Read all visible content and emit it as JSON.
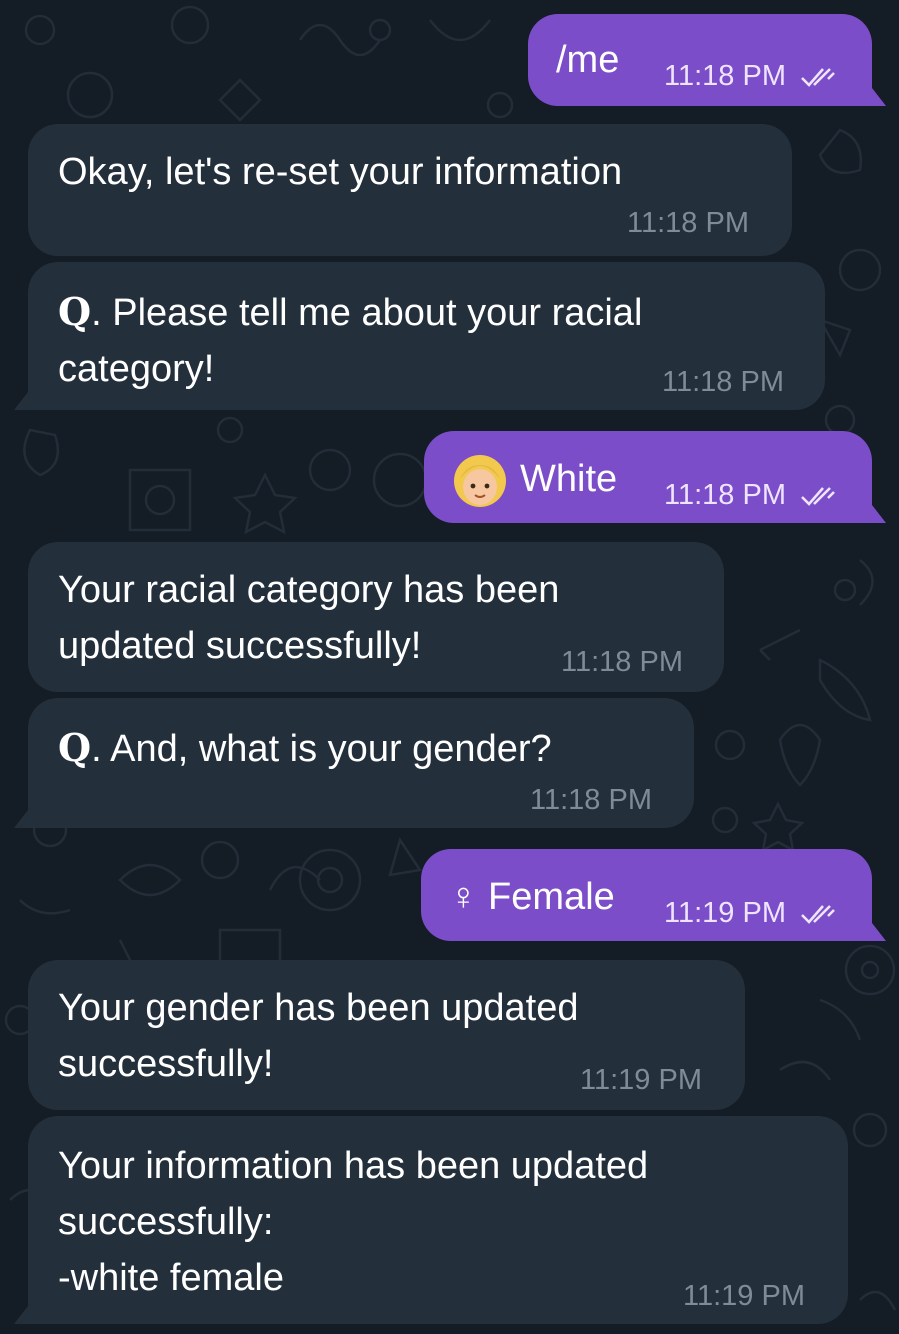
{
  "messages": [
    {
      "id": 1,
      "direction": "outgoing",
      "text": "/me",
      "time": "11:18 PM",
      "read_icon": "double-check-icon"
    },
    {
      "id": 2,
      "direction": "incoming",
      "text": "Okay, let's re-set your information",
      "time": "11:18 PM"
    },
    {
      "id": 3,
      "direction": "incoming",
      "q_label": "Q",
      "text": ". Please tell me about your racial\ncategory!",
      "time": "11:18 PM"
    },
    {
      "id": 4,
      "direction": "outgoing",
      "emoji": "girl-face-emoji-icon",
      "text": "White",
      "time": "11:18 PM",
      "read_icon": "double-check-icon"
    },
    {
      "id": 5,
      "direction": "incoming",
      "text": "Your racial category has been\nupdated successfully!",
      "time": "11:18 PM"
    },
    {
      "id": 6,
      "direction": "incoming",
      "q_label": "Q",
      "text": ". And, what is your gender?",
      "time": "11:18 PM"
    },
    {
      "id": 7,
      "direction": "outgoing",
      "text": "♀ Female",
      "time": "11:19 PM",
      "read_icon": "double-check-icon"
    },
    {
      "id": 8,
      "direction": "incoming",
      "text": "Your gender has been updated\nsuccessfully!",
      "time": "11:19 PM"
    },
    {
      "id": 9,
      "direction": "incoming",
      "text": "Your information has been updated\nsuccessfully:\n-white female",
      "time": "11:19 PM"
    }
  ],
  "colors": {
    "background": "#141c25",
    "incoming_bubble": "#232f3b",
    "outgoing_bubble": "#7c4dc8",
    "incoming_time": "#7f8b97",
    "outgoing_time": "#efe4ff"
  }
}
